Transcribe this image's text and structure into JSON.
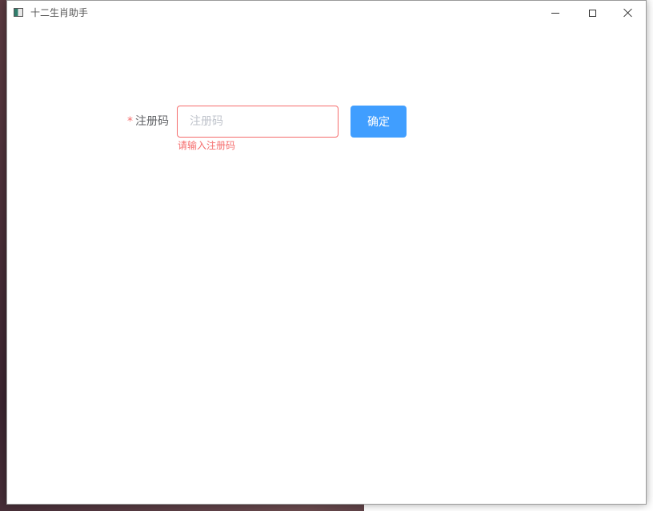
{
  "window": {
    "title": "十二生肖助手"
  },
  "form": {
    "required_mark": "*",
    "label": "注册码",
    "input_value": "",
    "input_placeholder": "注册码",
    "error_message": "请输入注册码",
    "confirm_label": "确定"
  },
  "colors": {
    "primary": "#409eff",
    "error": "#f56c6c",
    "label": "#606266",
    "placeholder": "#c0c4cc"
  },
  "icons": {
    "app": "app-window-icon",
    "minimize": "minimize-icon",
    "maximize": "maximize-icon",
    "close": "close-icon"
  }
}
